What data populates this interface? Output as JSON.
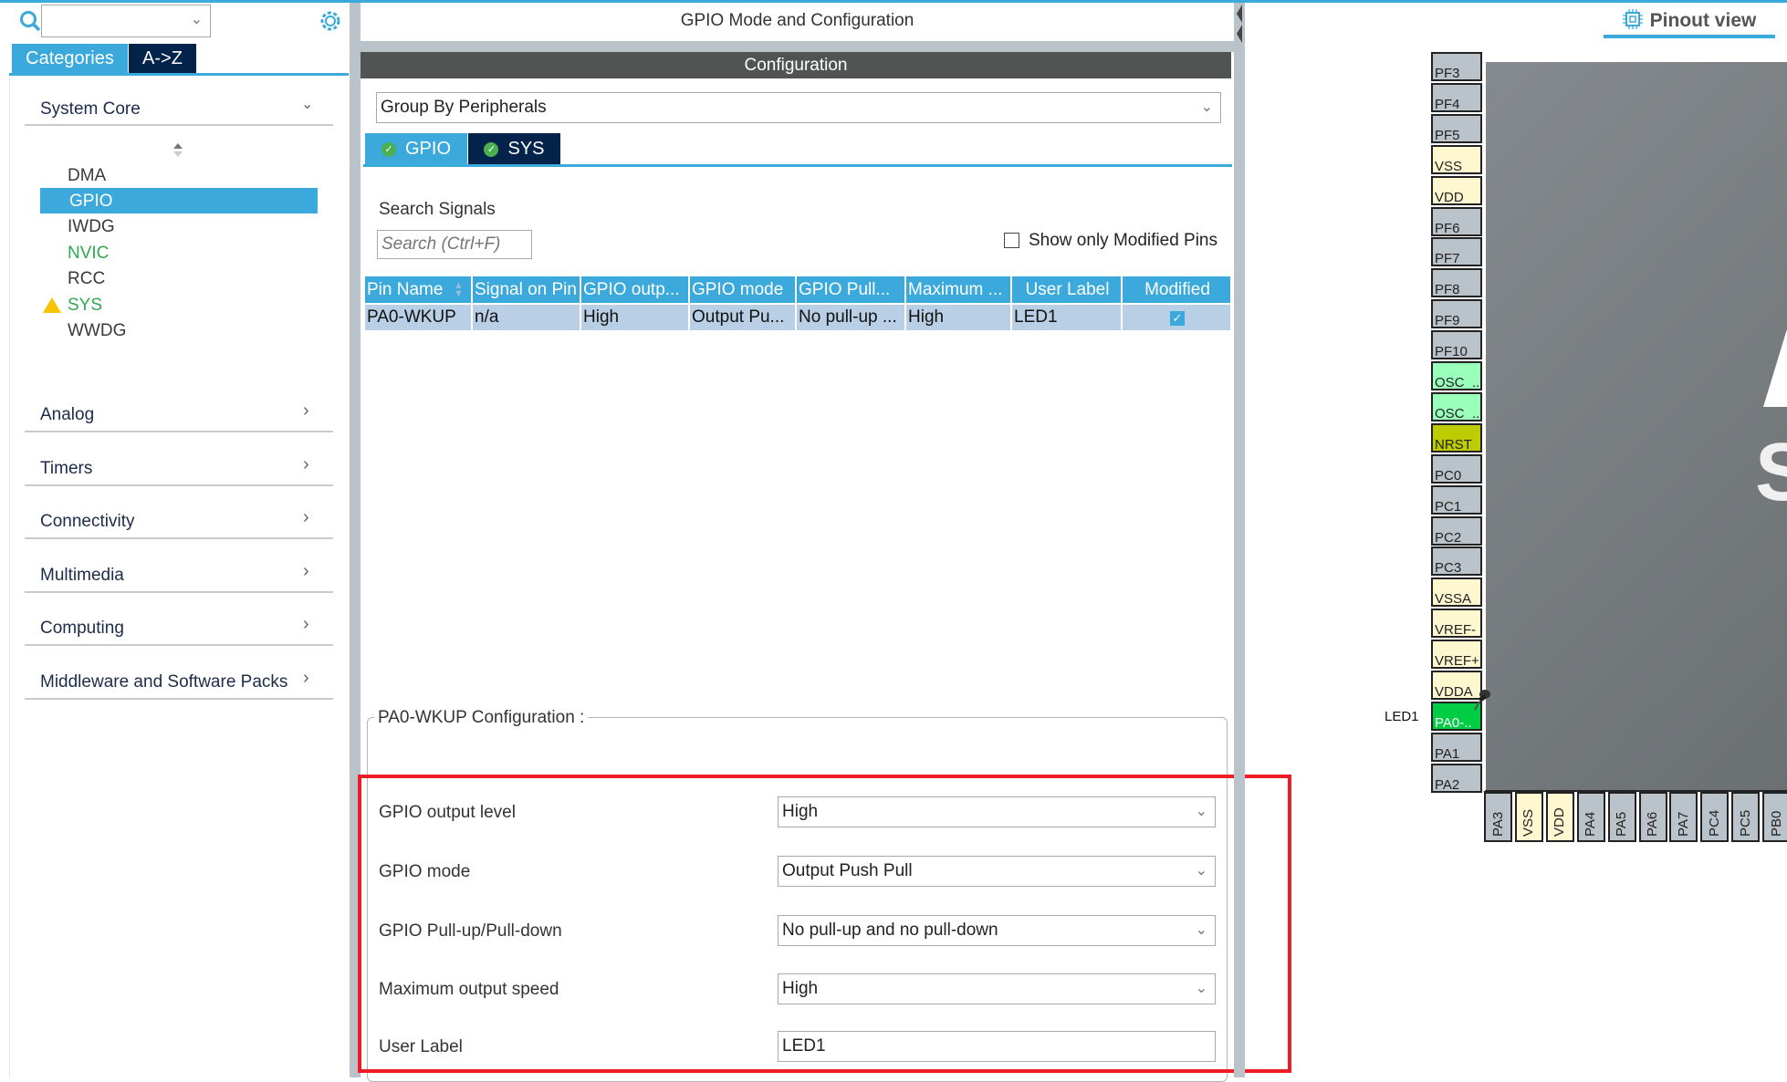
{
  "left": {
    "search_value": "",
    "tabs": [
      {
        "label": "Categories",
        "active": true
      },
      {
        "label": "A->Z",
        "active": false
      }
    ],
    "system_core": {
      "label": "System Core",
      "items": [
        {
          "label": "DMA",
          "color": "#3a3a3a"
        },
        {
          "label": "GPIO",
          "color": "#ffffff",
          "selected": true
        },
        {
          "label": "IWDG",
          "color": "#3a3a3a"
        },
        {
          "label": "NVIC",
          "color": "#2fa84f"
        },
        {
          "label": "RCC",
          "color": "#3a3a3a"
        },
        {
          "label": "SYS",
          "color": "#2fa84f",
          "warning": true
        },
        {
          "label": "WWDG",
          "color": "#3a3a3a"
        }
      ]
    },
    "categories": [
      {
        "label": "Analog"
      },
      {
        "label": "Timers"
      },
      {
        "label": "Connectivity"
      },
      {
        "label": "Multimedia"
      },
      {
        "label": "Computing"
      },
      {
        "label": "Middleware and Software Packs"
      }
    ]
  },
  "middle": {
    "title": "GPIO Mode and Configuration",
    "config_header": "Configuration",
    "group_by": "Group By Peripherals",
    "tabs": [
      {
        "label": "GPIO"
      },
      {
        "label": "SYS"
      }
    ],
    "search_label": "Search Signals",
    "search_placeholder": "Search (Ctrl+F)",
    "show_modified_label": "Show only Modified Pins",
    "show_modified_checked": false,
    "table": {
      "columns": [
        "Pin Name",
        "Signal on Pin",
        "GPIO outp...",
        "GPIO mode",
        "GPIO Pull...",
        "Maximum ...",
        "User Label",
        "Modified"
      ],
      "rows": [
        [
          "PA0-WKUP",
          "n/a",
          "High",
          "Output Pu...",
          "No pull-up ...",
          "High",
          "LED1",
          true
        ]
      ]
    },
    "pin_config": {
      "title": "PA0-WKUP Configuration :",
      "fields": [
        {
          "label": "GPIO output level",
          "value": "High",
          "type": "select"
        },
        {
          "label": "GPIO mode",
          "value": "Output Push Pull",
          "type": "select"
        },
        {
          "label": "GPIO Pull-up/Pull-down",
          "value": "No pull-up and no pull-down",
          "type": "select"
        },
        {
          "label": "Maximum output speed",
          "value": "High",
          "type": "select"
        },
        {
          "label": "User Label",
          "value": "LED1",
          "type": "text"
        }
      ]
    }
  },
  "right": {
    "tab_label": "Pinout view",
    "pin_label_led": "LED1",
    "left_pins": [
      {
        "name": "PF3",
        "type": "io"
      },
      {
        "name": "PF4",
        "type": "io"
      },
      {
        "name": "PF5",
        "type": "io"
      },
      {
        "name": "VSS",
        "type": "power"
      },
      {
        "name": "VDD",
        "type": "power"
      },
      {
        "name": "PF6",
        "type": "io"
      },
      {
        "name": "PF7",
        "type": "io"
      },
      {
        "name": "PF8",
        "type": "io"
      },
      {
        "name": "PF9",
        "type": "io"
      },
      {
        "name": "PF10",
        "type": "io"
      },
      {
        "name": "OSC_..",
        "type": "osc"
      },
      {
        "name": "OSC_..",
        "type": "osc"
      },
      {
        "name": "NRST",
        "type": "reset"
      },
      {
        "name": "PC0",
        "type": "io"
      },
      {
        "name": "PC1",
        "type": "io"
      },
      {
        "name": "PC2",
        "type": "io"
      },
      {
        "name": "PC3",
        "type": "io"
      },
      {
        "name": "VSSA",
        "type": "power"
      },
      {
        "name": "VREF-",
        "type": "power"
      },
      {
        "name": "VREF+",
        "type": "power"
      },
      {
        "name": "VDDA",
        "type": "power"
      },
      {
        "name": "PA0-..",
        "type": "assigned"
      },
      {
        "name": "PA1",
        "type": "io"
      },
      {
        "name": "PA2",
        "type": "io"
      }
    ],
    "bottom_pins": [
      {
        "name": "PA3",
        "type": "io"
      },
      {
        "name": "VSS",
        "type": "power"
      },
      {
        "name": "VDD",
        "type": "power"
      },
      {
        "name": "PA4",
        "type": "io"
      },
      {
        "name": "PA5",
        "type": "io"
      },
      {
        "name": "PA6",
        "type": "io"
      },
      {
        "name": "PA7",
        "type": "io"
      },
      {
        "name": "PC4",
        "type": "io"
      },
      {
        "name": "PC5",
        "type": "io"
      },
      {
        "name": "PB0",
        "type": "io"
      }
    ],
    "pin_colors": {
      "io": "#b9c3c9",
      "power": "#fff7d0",
      "osc": "#99ffbb",
      "reset": "#bccc00",
      "assigned": "#00cc44"
    }
  },
  "colors": {
    "accent": "#3ba9dc",
    "dark_tab": "#03234b",
    "highlight": "#ee1c25"
  }
}
